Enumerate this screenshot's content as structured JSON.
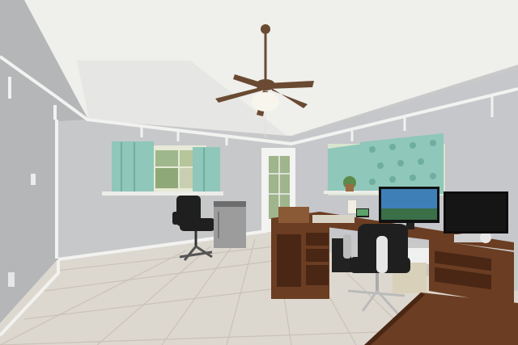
{
  "scene": {
    "description_label": "",
    "colors": {
      "ceiling": "#efefec",
      "wall_left": "#b4b6b8",
      "wall_back": "#c7c8ca",
      "wall_right": "#c5c7ca",
      "floor": "#ddd8cf",
      "floor_grout": "#c8c2b8",
      "trim": "#f2f2f0",
      "curtain": "#8fc7ba",
      "curtain_dark": "#6fae9f",
      "wood_desk": "#6b3d22",
      "wood_dark": "#4a2714",
      "chair_black": "#1f1f1f",
      "fan_bronze": "#6a4a32",
      "fridge": "#9c9c9c",
      "monitor_screen": "#3f7fb8",
      "tv_screen": "#151515"
    }
  }
}
